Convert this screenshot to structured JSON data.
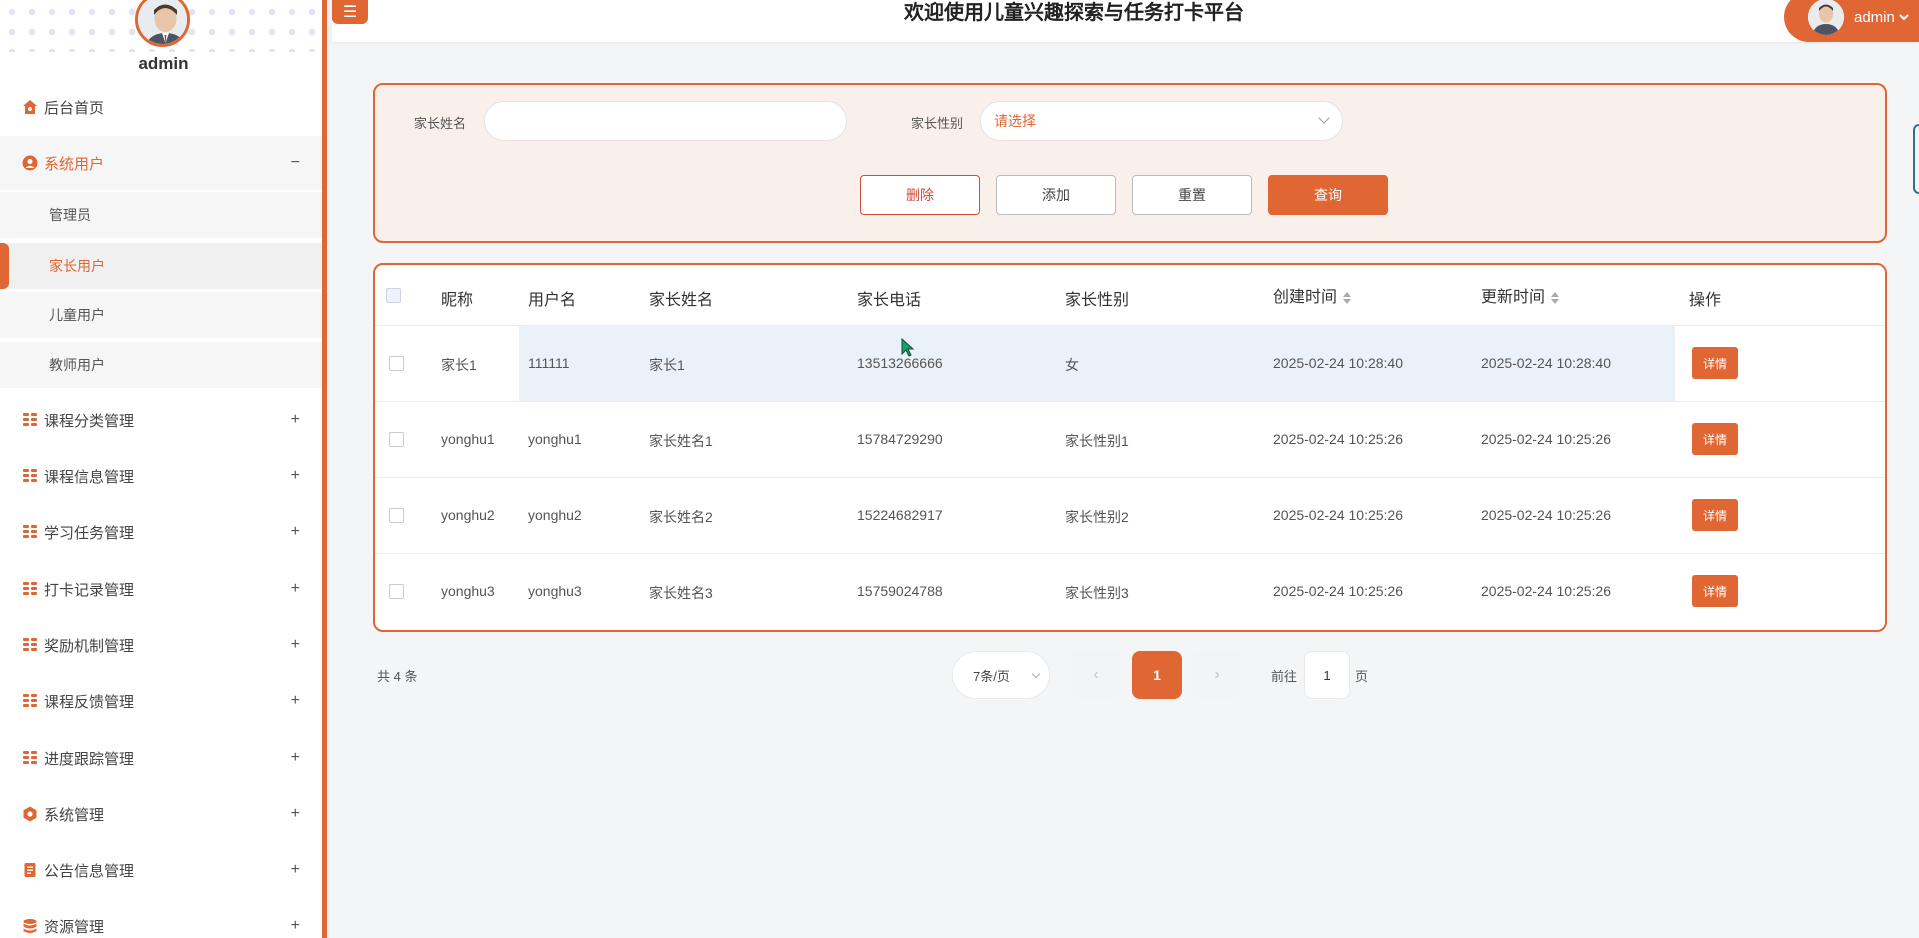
{
  "colors": {
    "accent": "#e06634",
    "danger": "#d14b3a",
    "hover_row": "#ebf1f8"
  },
  "sidebar": {
    "user_name": "admin",
    "menu": [
      {
        "label": "后台首页",
        "icon": "home-icon"
      },
      {
        "label": "系统用户",
        "icon": "user-circle-icon",
        "toggle": "−",
        "expanded": true,
        "children": [
          "管理员",
          "家长用户",
          "儿童用户",
          "教师用户"
        ],
        "active_child": "家长用户"
      },
      {
        "label": "课程分类管理",
        "icon": "grid-icon",
        "toggle": "+"
      },
      {
        "label": "课程信息管理",
        "icon": "grid-icon",
        "toggle": "+"
      },
      {
        "label": "学习任务管理",
        "icon": "grid-icon",
        "toggle": "+"
      },
      {
        "label": "打卡记录管理",
        "icon": "grid-icon",
        "toggle": "+"
      },
      {
        "label": "奖励机制管理",
        "icon": "grid-icon",
        "toggle": "+"
      },
      {
        "label": "课程反馈管理",
        "icon": "grid-icon",
        "toggle": "+"
      },
      {
        "label": "进度跟踪管理",
        "icon": "grid-icon",
        "toggle": "+"
      },
      {
        "label": "系统管理",
        "icon": "gear-icon",
        "toggle": "+"
      },
      {
        "label": "公告信息管理",
        "icon": "notice-icon",
        "toggle": "+"
      },
      {
        "label": "资源管理",
        "icon": "database-icon",
        "toggle": "+"
      }
    ]
  },
  "header": {
    "menu_button": "☰",
    "title": "欢迎使用儿童兴趣探索与任务打卡平台",
    "user_label": "admin"
  },
  "search": {
    "name_label": "家长姓名",
    "name_value": "",
    "gender_label": "家长性别",
    "gender_placeholder": "请选择",
    "buttons": {
      "delete": "删除",
      "add": "添加",
      "reset": "重置",
      "query": "查询"
    }
  },
  "table": {
    "columns": [
      "昵称",
      "用户名",
      "家长姓名",
      "家长电话",
      "家长性别",
      "创建时间",
      "更新时间",
      "操作"
    ],
    "action_label": "详情",
    "rows": [
      {
        "nickname": "家长1",
        "username": "111111",
        "name": "家长1",
        "phone": "13513266666",
        "gender": "女",
        "created": "2025-02-24 10:28:40",
        "updated": "2025-02-24 10:28:40"
      },
      {
        "nickname": "yonghu1",
        "username": "yonghu1",
        "name": "家长姓名1",
        "phone": "15784729290",
        "gender": "家长性别1",
        "created": "2025-02-24 10:25:26",
        "updated": "2025-02-24 10:25:26"
      },
      {
        "nickname": "yonghu2",
        "username": "yonghu2",
        "name": "家长姓名2",
        "phone": "15224682917",
        "gender": "家长性别2",
        "created": "2025-02-24 10:25:26",
        "updated": "2025-02-24 10:25:26"
      },
      {
        "nickname": "yonghu3",
        "username": "yonghu3",
        "name": "家长姓名3",
        "phone": "15759024788",
        "gender": "家长性别3",
        "created": "2025-02-24 10:25:26",
        "updated": "2025-02-24 10:25:26"
      }
    ]
  },
  "pagination": {
    "total": "共 4 条",
    "page_size": "7条/页",
    "prev": "‹",
    "current": "1",
    "next": "›",
    "goto_prefix": "前往",
    "goto_value": "1",
    "goto_suffix": "页"
  }
}
